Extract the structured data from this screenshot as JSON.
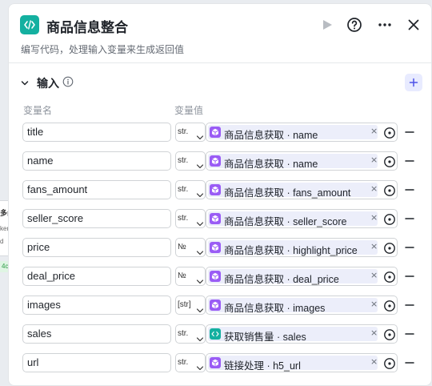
{
  "header": {
    "title": "商品信息整合",
    "description": "编写代码，处理输入变量来生成返回值",
    "icons": {
      "app": "code-icon",
      "run": "play-icon",
      "help": "help-icon",
      "more": "more-icon",
      "close": "close-icon"
    }
  },
  "background": {
    "node_title_fragment": "多纟",
    "node_line2": "ken",
    "node_line3": "d",
    "node_badge": "4c"
  },
  "input_section": {
    "title": "输入",
    "columns": {
      "name": "变量名",
      "value": "变量值"
    },
    "rows": [
      {
        "name": "title",
        "type": "str.",
        "ref_icon": "cube-icon",
        "ref": "商品信息获取 · name"
      },
      {
        "name": "name",
        "type": "str.",
        "ref_icon": "cube-icon",
        "ref": "商品信息获取 · name"
      },
      {
        "name": "fans_amount",
        "type": "str.",
        "ref_icon": "cube-icon",
        "ref": "商品信息获取 · fans_amount"
      },
      {
        "name": "seller_score",
        "type": "str.",
        "ref_icon": "cube-icon",
        "ref": "商品信息获取 · seller_score"
      },
      {
        "name": "price",
        "type": "№",
        "ref_icon": "cube-icon",
        "ref": "商品信息获取 · highlight_price"
      },
      {
        "name": "deal_price",
        "type": "№",
        "ref_icon": "cube-icon",
        "ref": "商品信息获取 · deal_price"
      },
      {
        "name": "images",
        "type": "[str]",
        "ref_icon": "cube-icon",
        "ref": "商品信息获取 · images"
      },
      {
        "name": "sales",
        "type": "str.",
        "ref_icon": "code-icon",
        "ref": "获取销售量 · sales"
      },
      {
        "name": "url",
        "type": "str.",
        "ref_icon": "cube-icon",
        "ref": "链接处理 · h5_url"
      }
    ]
  },
  "colors": {
    "cube_icon": "#9a5cf5",
    "code_icon": "#14b0a0",
    "add_button_bg": "#e8ebff",
    "accent": "#4d53e8"
  }
}
